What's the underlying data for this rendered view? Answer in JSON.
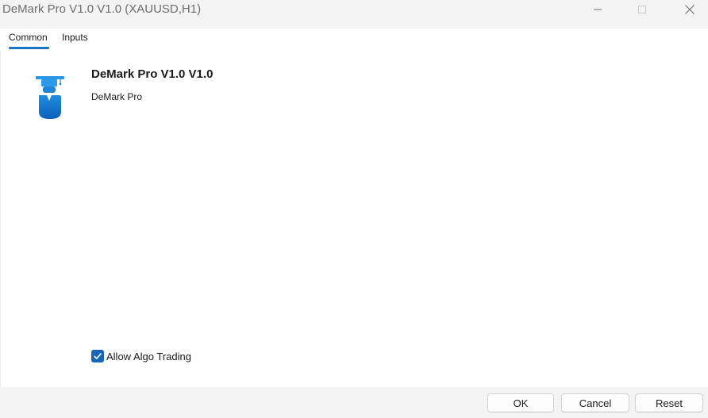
{
  "window": {
    "title": "DeMark Pro V1.0 V1.0 (XAUUSD,H1)"
  },
  "tabs": [
    {
      "label": "Common",
      "active": true
    },
    {
      "label": "Inputs",
      "active": false
    }
  ],
  "program": {
    "name": "DeMark Pro V1.0 V1.0",
    "description": "DeMark Pro",
    "icon": "graduate-user-icon"
  },
  "options": {
    "allow_algo_trading_label": "Allow Algo Trading",
    "allow_algo_trading_checked": true
  },
  "buttons": {
    "ok": "OK",
    "cancel": "Cancel",
    "reset": "Reset"
  },
  "colors": {
    "accent": "#1a73c4",
    "checkbox": "#1467b8"
  }
}
